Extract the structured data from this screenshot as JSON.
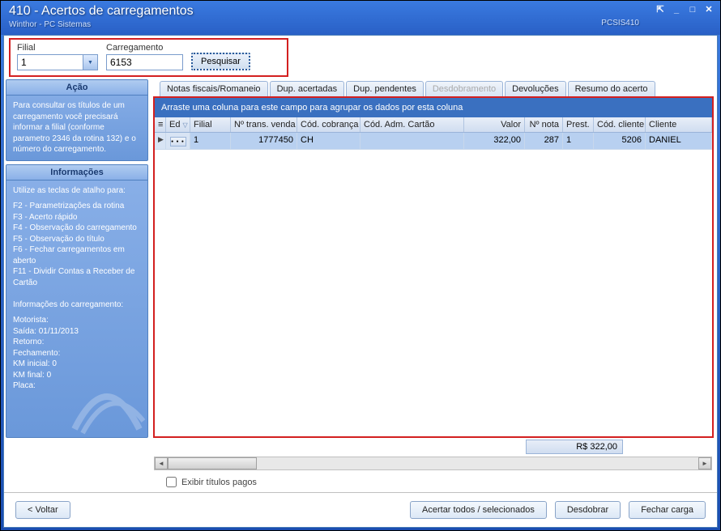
{
  "window": {
    "title": "410 - Acertos de carregamentos",
    "subtitle": "Winthor - PC Sistemas",
    "code": "PCSIS410"
  },
  "search": {
    "filial_label": "Filial",
    "filial_value": "1",
    "carregamento_label": "Carregamento",
    "carregamento_value": "6153",
    "pesquisar_label": "Pesquisar"
  },
  "sidebar": {
    "acao": {
      "title": "Ação",
      "text": "Para consultar os títulos de um carregamento você precisará informar a filial (conforme parametro 2346 da rotina 132) e o número do carregamento."
    },
    "info": {
      "title": "Informações",
      "shortcuts_title": "Utilize as teclas de atalho para:",
      "shortcuts": [
        "F2 - Parametrizações da rotina",
        "F3 - Acerto rápido",
        "F4 - Observação do carregamento",
        "F5 - Observação do título",
        "F6 - Fechar carregamentos em aberto",
        "F11 - Dividir Contas a Receber de Cartão"
      ],
      "load_title": "Informações do carregamento:",
      "load_lines": [
        "Motorista:",
        "Saída: 01/11/2013",
        "Retorno:",
        "Fechamento:",
        "KM inicial: 0",
        "KM final: 0",
        "Placa:"
      ]
    }
  },
  "tabs": [
    {
      "label": "Notas fiscais/Romaneio",
      "disabled": false
    },
    {
      "label": "Dup. acertadas",
      "disabled": false
    },
    {
      "label": "Dup. pendentes",
      "disabled": false
    },
    {
      "label": "Desdobramento",
      "disabled": true
    },
    {
      "label": "Devoluções",
      "disabled": false
    },
    {
      "label": "Resumo do acerto",
      "disabled": false
    }
  ],
  "group_bar": "Arraste uma coluna para este campo para agrupar os dados por esta coluna",
  "grid": {
    "headers": {
      "ed": "Ed",
      "filial": "Filial",
      "trans": "Nº trans. venda",
      "cob": "Cód. cobrança",
      "adm": "Cód. Adm. Cartão",
      "valor": "Valor",
      "nota": "Nº nota",
      "prest": "Prest.",
      "ccli": "Cód. cliente",
      "cliente": "Cliente"
    },
    "row": {
      "filial": "1",
      "trans": "1777450",
      "cob": "CH",
      "adm": "",
      "valor": "322,00",
      "nota": "287",
      "prest": "1",
      "ccli": "5206",
      "cliente": "DANIEL "
    }
  },
  "total": "R$ 322,00",
  "checkbox_label": "Exibir títulos pagos",
  "buttons": {
    "voltar": "< Voltar",
    "acertar": "Acertar todos / selecionados",
    "desdobrar": "Desdobrar",
    "fechar": "Fechar carga"
  }
}
